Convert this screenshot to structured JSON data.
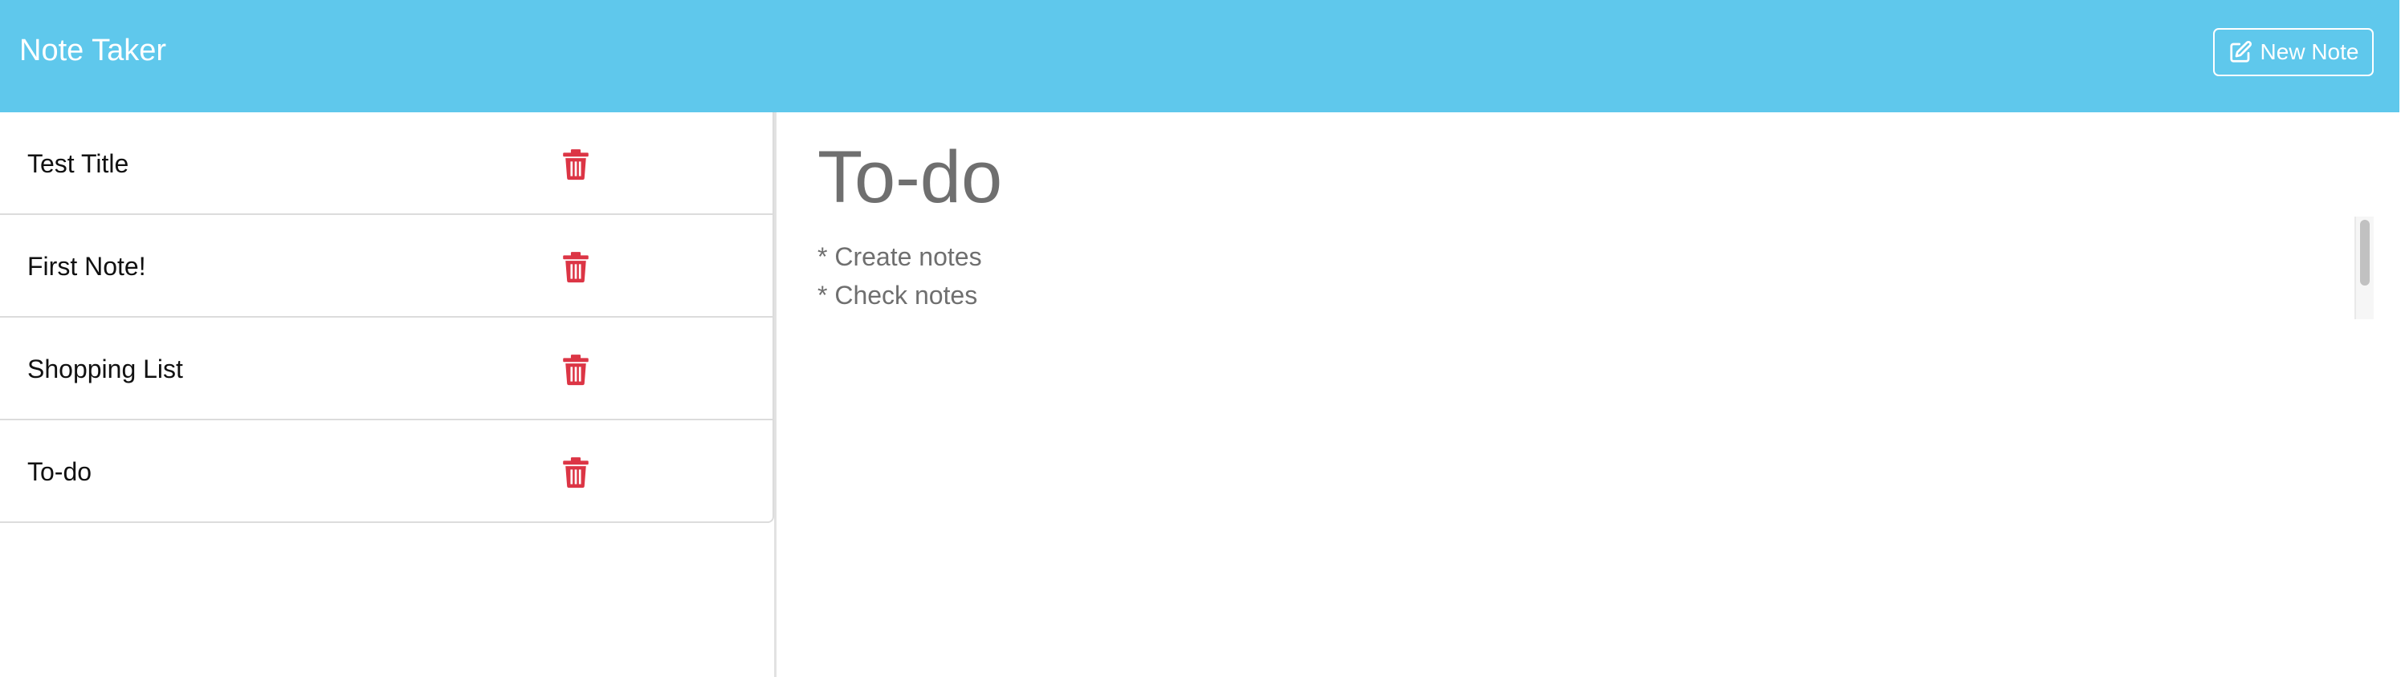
{
  "navbar": {
    "brand": "Note Taker",
    "new_note_label": "New Note",
    "background_color": "#5fc8ec",
    "new_note_icon": "edit-icon"
  },
  "notes": [
    {
      "title": "Test Title",
      "delete_icon": "trash-icon"
    },
    {
      "title": "First Note!",
      "delete_icon": "trash-icon"
    },
    {
      "title": "Shopping List",
      "delete_icon": "trash-icon"
    },
    {
      "title": "To-do",
      "delete_icon": "trash-icon"
    }
  ],
  "active_note": {
    "title": "To-do",
    "text": "* Create notes\n* Check notes"
  },
  "colors": {
    "delete": "#dc3545",
    "note_text": "#6f6f6f"
  }
}
